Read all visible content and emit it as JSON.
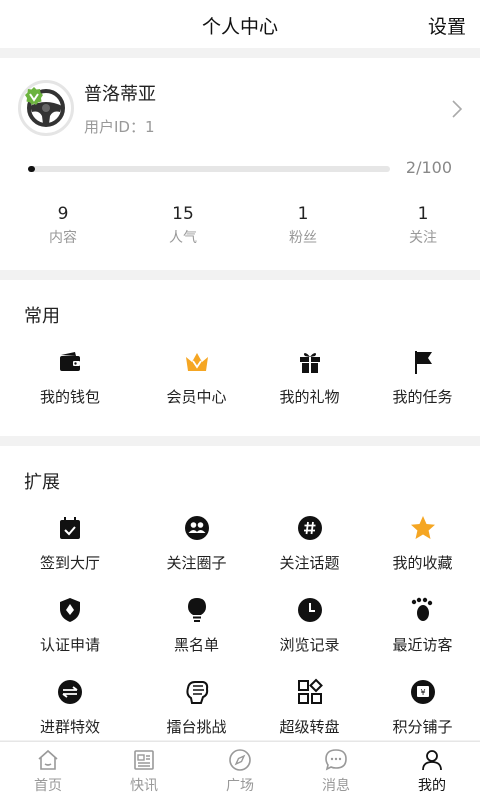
{
  "header": {
    "title": "个人中心",
    "settings_label": "设置"
  },
  "profile": {
    "name": "普洛蒂亚",
    "user_id": "用户ID：1",
    "progress_text": "2/100",
    "progress_fraction": 0.02,
    "stats": [
      {
        "value": "9",
        "label": "内容"
      },
      {
        "value": "15",
        "label": "人气"
      },
      {
        "value": "1",
        "label": "粉丝"
      },
      {
        "value": "1",
        "label": "关注"
      }
    ]
  },
  "common": {
    "title": "常用",
    "items": [
      {
        "label": "我的钱包",
        "icon": "wallet-icon"
      },
      {
        "label": "会员中心",
        "icon": "crown-icon"
      },
      {
        "label": "我的礼物",
        "icon": "gift-icon"
      },
      {
        "label": "我的任务",
        "icon": "flag-icon"
      }
    ]
  },
  "extend": {
    "title": "扩展",
    "items": [
      {
        "label": "签到大厅",
        "icon": "calendar-check-icon"
      },
      {
        "label": "关注圈子",
        "icon": "group-icon"
      },
      {
        "label": "关注话题",
        "icon": "hashtag-icon"
      },
      {
        "label": "我的收藏",
        "icon": "star-icon"
      },
      {
        "label": "认证申请",
        "icon": "shield-icon"
      },
      {
        "label": "黑名单",
        "icon": "bulb-icon"
      },
      {
        "label": "浏览记录",
        "icon": "clock-icon"
      },
      {
        "label": "最近访客",
        "icon": "footprint-icon"
      },
      {
        "label": "进群特效",
        "icon": "switch-icon"
      },
      {
        "label": "擂台挑战",
        "icon": "fist-icon"
      },
      {
        "label": "超级转盘",
        "icon": "apps-icon"
      },
      {
        "label": "积分铺子",
        "icon": "shop-icon"
      }
    ]
  },
  "tabs": [
    {
      "label": "首页",
      "icon": "home-icon"
    },
    {
      "label": "快讯",
      "icon": "news-icon"
    },
    {
      "label": "广场",
      "icon": "compass-icon"
    },
    {
      "label": "消息",
      "icon": "message-icon"
    },
    {
      "label": "我的",
      "icon": "user-icon",
      "active": true
    }
  ],
  "colors": {
    "accent": "#f5a623",
    "badge_green": "#6cb33f",
    "text": "#222222",
    "muted": "#999999"
  }
}
